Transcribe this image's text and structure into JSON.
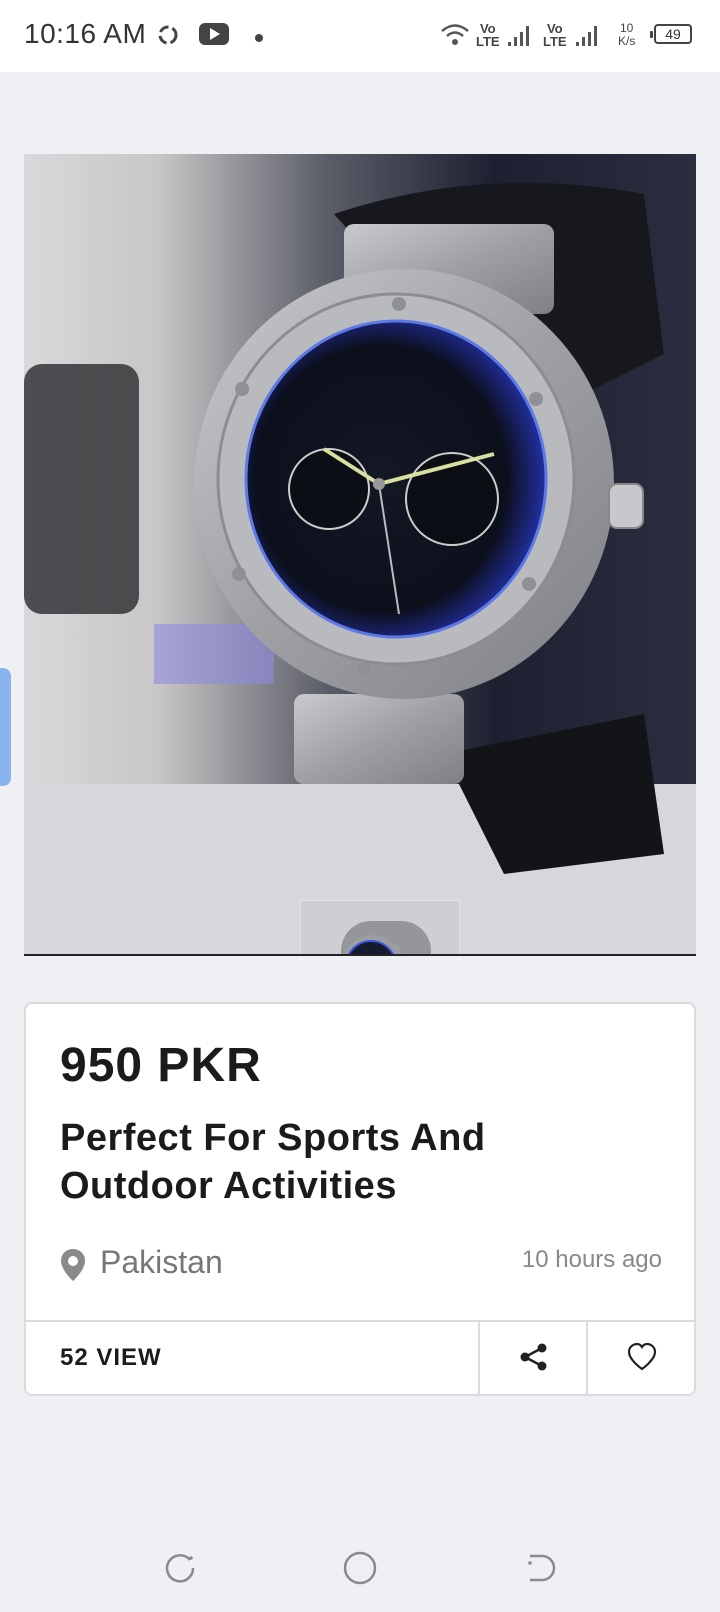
{
  "status_bar": {
    "time": "10:16 AM",
    "net_1": "Vo",
    "net_1b": "LTE",
    "net_2": "Vo",
    "net_2b": "LTE",
    "speed_value": "10",
    "speed_unit": "K/s",
    "battery": "49",
    "icons": [
      "sync-icon",
      "youtube-icon",
      "dot-icon",
      "wifi-icon",
      "signal-icon",
      "signal-icon"
    ]
  },
  "product": {
    "image_alt": "wrist-watch-photo",
    "price": "950 PKR",
    "title": "Perfect For Sports And Outdoor Activities",
    "location": "Pakistan",
    "posted": "10 hours ago",
    "views": "52 VIEW"
  },
  "actions": {
    "share_icon": "share-icon",
    "like_icon": "heart-icon"
  },
  "colors": {
    "accent_edge": "#8ab4f0",
    "background": "#eff0f4",
    "card": "#ffffff"
  }
}
